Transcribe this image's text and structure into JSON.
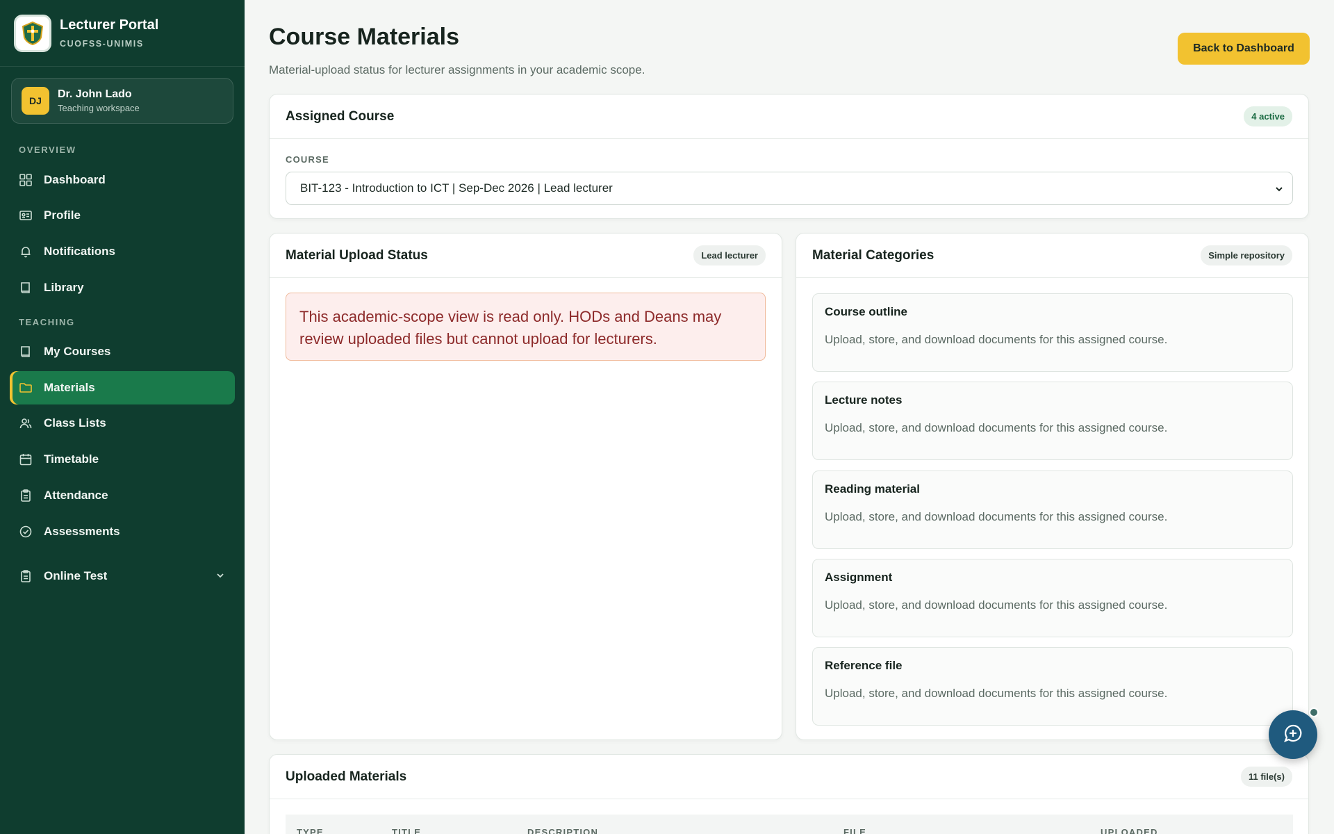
{
  "brand": {
    "title": "Lecturer Portal",
    "subtitle": "CUOFSS-UNIMIS"
  },
  "user": {
    "initials": "DJ",
    "name": "Dr. John Lado",
    "role": "Teaching workspace"
  },
  "sidebar": {
    "sections": [
      "OVERVIEW",
      "TEACHING"
    ],
    "items": [
      {
        "label": "Dashboard",
        "icon": "grid-icon"
      },
      {
        "label": "Profile",
        "icon": "id-card-icon"
      },
      {
        "label": "Notifications",
        "icon": "bell-icon"
      },
      {
        "label": "Library",
        "icon": "book-icon"
      },
      {
        "label": "My Courses",
        "icon": "book-icon"
      },
      {
        "label": "Materials",
        "icon": "folder-icon",
        "active": true
      },
      {
        "label": "Class Lists",
        "icon": "users-icon"
      },
      {
        "label": "Timetable",
        "icon": "calendar-icon"
      },
      {
        "label": "Attendance",
        "icon": "clipboard-icon"
      },
      {
        "label": "Assessments",
        "icon": "check-circle-icon"
      },
      {
        "label": "Online Test",
        "icon": "clipboard-icon"
      }
    ]
  },
  "header": {
    "title": "Course Materials",
    "subtitle": "Material-upload status for lecturer assignments in your academic scope.",
    "back_label": "Back to Dashboard"
  },
  "assigned_course": {
    "title": "Assigned Course",
    "badge": "4 active",
    "field_label": "COURSE",
    "selected": "BIT-123 - Introduction to ICT | Sep-Dec 2026 | Lead lecturer"
  },
  "upload_status": {
    "title": "Material Upload Status",
    "badge": "Lead lecturer",
    "alert": "This academic-scope view is read only. HODs and Deans may review uploaded files but cannot upload for lecturers."
  },
  "categories": {
    "title": "Material Categories",
    "badge": "Simple repository",
    "items": [
      {
        "title": "Course outline",
        "desc": "Upload, store, and download documents for this assigned course."
      },
      {
        "title": "Lecture notes",
        "desc": "Upload, store, and download documents for this assigned course."
      },
      {
        "title": "Reading material",
        "desc": "Upload, store, and download documents for this assigned course."
      },
      {
        "title": "Assignment",
        "desc": "Upload, store, and download documents for this assigned course."
      },
      {
        "title": "Reference file",
        "desc": "Upload, store, and download documents for this assigned course."
      }
    ]
  },
  "uploaded": {
    "title": "Uploaded Materials",
    "badge": "11 file(s)",
    "columns": [
      "TYPE",
      "TITLE",
      "DESCRIPTION",
      "FILE",
      "UPLOADED"
    ]
  },
  "colors": {
    "sidebar": "#0f3d2f",
    "accent": "#f2c230",
    "active_nav": "#1a7a4b",
    "alert_bg": "#fdeeed",
    "fab": "#1f5a7e"
  }
}
